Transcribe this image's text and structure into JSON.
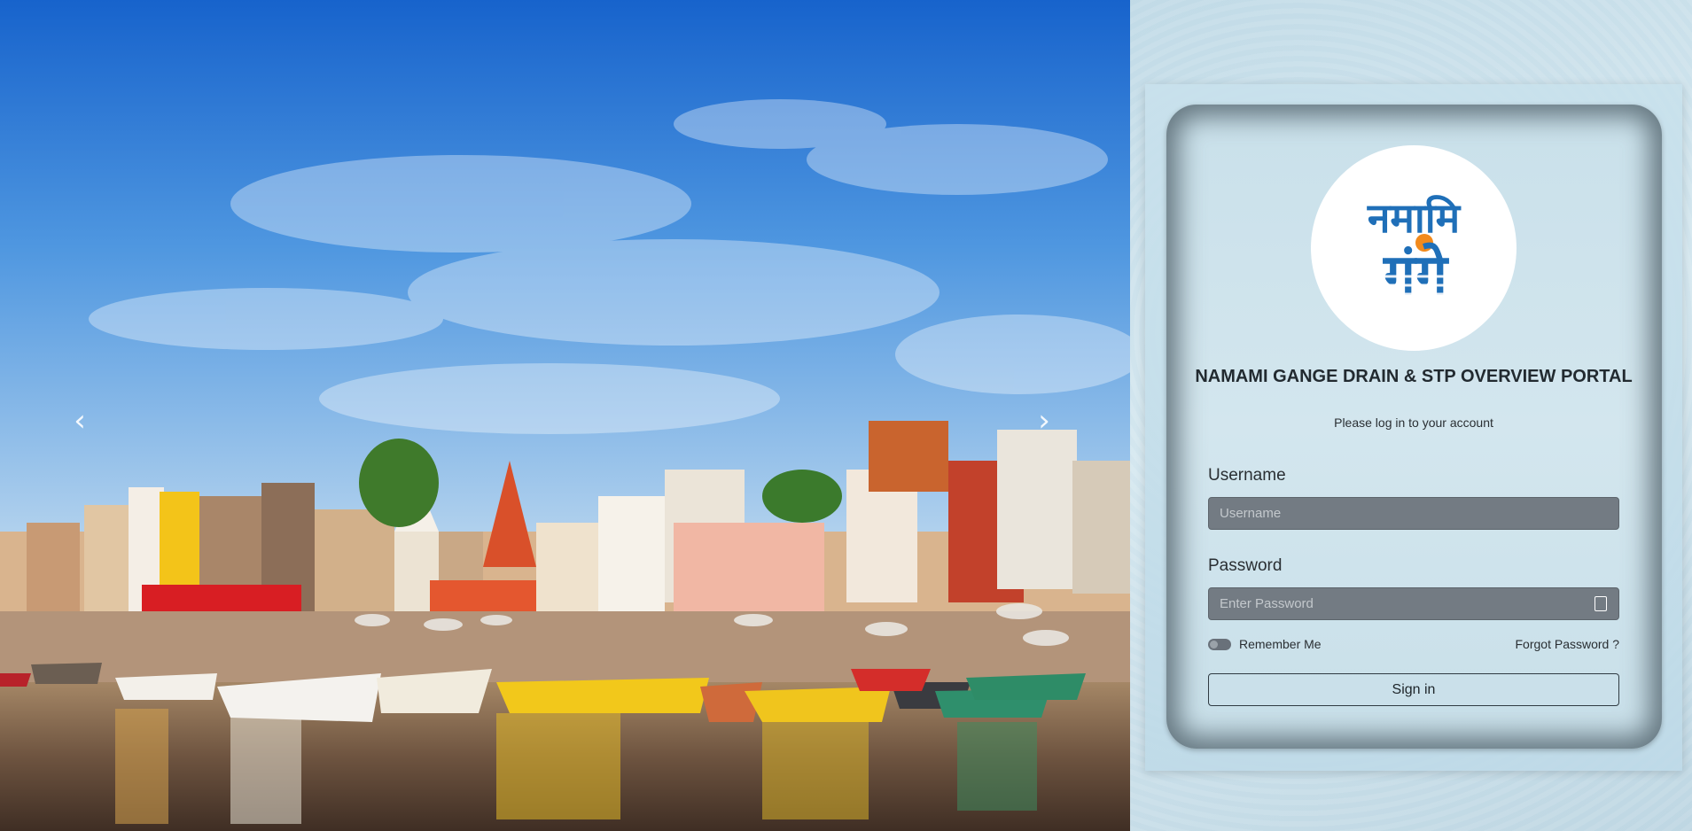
{
  "carousel": {
    "prev_symbol": "‹",
    "next_symbol": "›"
  },
  "logo": {
    "line1": "नमामि",
    "line2": "गंगे"
  },
  "login": {
    "title": "NAMAMI GANGE DRAIN & STP OVERVIEW PORTAL",
    "subtitle": "Please log in to your account",
    "username_label": "Username",
    "username_placeholder": "Username",
    "username_value": "",
    "password_label": "Password",
    "password_placeholder": "Enter Password",
    "password_value": "",
    "remember_label": "Remember Me",
    "remember_checked": false,
    "forgot_label": "Forgot Password ?",
    "signin_label": "Sign in"
  },
  "icons": {
    "password_toggle": "eye-icon"
  },
  "colors": {
    "logo_blue": "#1f6fb8",
    "logo_orange": "#f28a1c",
    "input_bg": "#737b83"
  }
}
